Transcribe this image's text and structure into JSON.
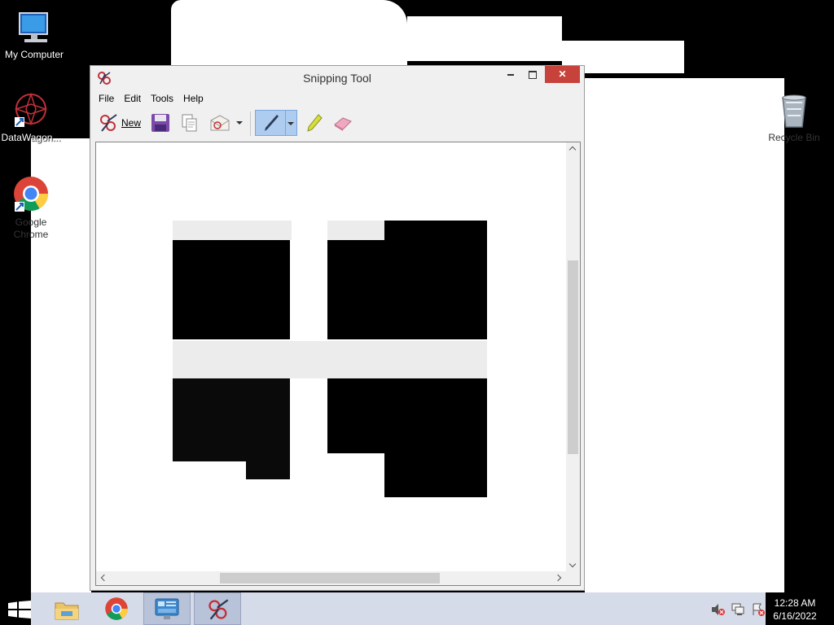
{
  "desktop": {
    "icons": [
      {
        "label": "My Computer"
      },
      {
        "label": "DataWagon..."
      },
      {
        "label": "Google Chrome"
      },
      {
        "label": "Recycle Bin"
      }
    ]
  },
  "window": {
    "title": "Snipping Tool",
    "menu": [
      "File",
      "Edit",
      "Tools",
      "Help"
    ],
    "toolbar": {
      "new_label": "New"
    }
  },
  "taskbar": {
    "time": "12:28 AM",
    "date": "6/16/2022"
  },
  "colors": {
    "taskbar": "#d6dbe9",
    "close": "#c7423b",
    "pen_active": "#aecbf0"
  }
}
